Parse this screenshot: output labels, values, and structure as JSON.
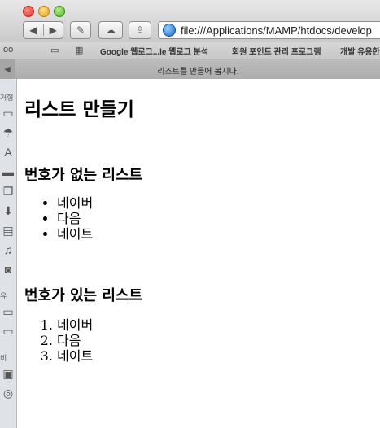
{
  "browser": {
    "url": "file:///Applications/MAMP/htdocs/develop",
    "tab_title": "리스트를 만들어 봅시다.",
    "bookmarks": [
      "Google 웹로그...le 웹로그 분석",
      "회원 포인트 관리 프로그램",
      "개발 유용한"
    ]
  },
  "sidebar_sliver": {
    "labels": [
      "거형",
      "유",
      "비"
    ]
  },
  "page": {
    "title": "리스트 만들기",
    "unordered": {
      "heading": "번호가 없는 리스트",
      "items": [
        "네이버",
        "다음",
        "네이트"
      ]
    },
    "ordered": {
      "heading": "번호가 있는 리스트",
      "items": [
        "네이버",
        "다음",
        "네이트"
      ]
    }
  }
}
